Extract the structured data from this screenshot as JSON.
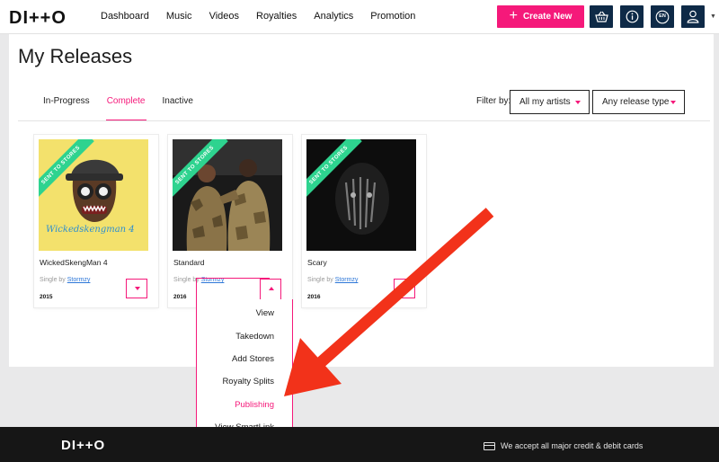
{
  "brand": {
    "logo": "DI++O",
    "accent": "#f5197a",
    "navy": "#0e2a47",
    "ribbon": "#2ed38f"
  },
  "nav": {
    "links": [
      "Dashboard",
      "Music",
      "Videos",
      "Royalties",
      "Analytics",
      "Promotion"
    ],
    "create_label": "Create New",
    "icons": [
      "basket-icon",
      "info-icon",
      "language-icon",
      "user-icon"
    ],
    "language": "EN"
  },
  "page": {
    "title": "My Releases"
  },
  "tabs": [
    {
      "label": "In-Progress",
      "active": false
    },
    {
      "label": "Complete",
      "active": true
    },
    {
      "label": "Inactive",
      "active": false
    }
  ],
  "filter": {
    "label": "Filter by:",
    "artist_value": "All my artists",
    "type_value": "Any release type"
  },
  "releases": [
    {
      "title": "WickedSkengMan 4",
      "type_prefix": "Single by",
      "artist": "Stormzy",
      "year": "2015",
      "ribbon": "SENT TO STORES",
      "cover_text": "Wickedskengman 4"
    },
    {
      "title": "Standard",
      "type_prefix": "Single by",
      "artist": "Stormzy",
      "year": "2016",
      "ribbon": "SENT TO STORES"
    },
    {
      "title": "Scary",
      "type_prefix": "Single by",
      "artist": "Stormzy",
      "year": "2016",
      "ribbon": "SENT TO STORES"
    }
  ],
  "menu": {
    "items": [
      {
        "label": "View",
        "highlight": false
      },
      {
        "label": "Takedown",
        "highlight": false
      },
      {
        "label": "Add Stores",
        "highlight": false
      },
      {
        "label": "Royalty Splits",
        "highlight": false
      },
      {
        "label": "Publishing",
        "highlight": true
      },
      {
        "label": "View SmartLink",
        "highlight": false
      }
    ]
  },
  "footer": {
    "logo": "DI++O",
    "note": "We accept all major credit & debit cards"
  }
}
